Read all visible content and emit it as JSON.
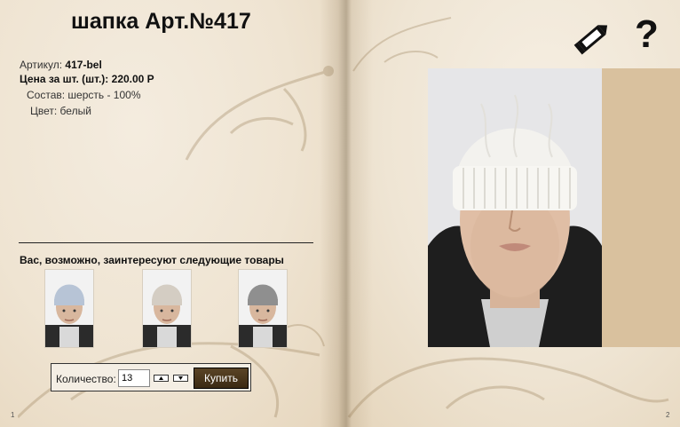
{
  "product": {
    "title": "шапка Арт.№417",
    "article_label": "Артикул:",
    "article_value": "417-bel",
    "price_label": "Цена за шт. (шт.):",
    "price_value": "220.00 Р",
    "composition": "Состав: шерсть - 100%",
    "color": "Цвет: белый"
  },
  "suggestions": {
    "heading": "Вас, возможно, заинтересуют следующие товары",
    "items": [
      {
        "hat_color": "#b7c4d6"
      },
      {
        "hat_color": "#d4cdc3"
      },
      {
        "hat_color": "#8f8f8f"
      }
    ]
  },
  "order": {
    "quantity_label": "Количество:",
    "quantity_value": "13",
    "buy_label": "Купить"
  },
  "toolbar": {
    "edit_icon": "pencil-icon",
    "help_label": "?"
  },
  "pages": {
    "left": "1",
    "right": "2"
  },
  "colors": {
    "page": "#efe6d6",
    "button": "#4a3519",
    "main_hat": "#f3f2ee"
  }
}
